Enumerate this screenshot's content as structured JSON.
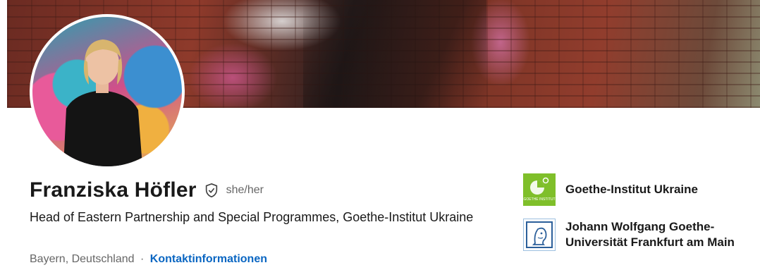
{
  "profile": {
    "name": "Franziska Höfler",
    "pronouns": "she/her",
    "headline": "Head of Eastern Partnership and Special Programmes, Goethe-Institut Ukraine",
    "location": "Bayern, Deutschland",
    "separator": "·",
    "contact_link": "Kontaktinformationen",
    "verified_icon": "shield-check-icon"
  },
  "organizations": [
    {
      "name": "Goethe-Institut Ukraine",
      "logo": "goethe-institut-logo",
      "logo_text": "GOETHE INSTITUT"
    },
    {
      "name": "Johann Wolfgang Goethe-Universität Frankfurt am Main",
      "logo": "goethe-university-logo"
    }
  ],
  "colors": {
    "link": "#0a66c2",
    "goethe_green": "#7fbf2a",
    "text_primary": "#191919",
    "text_secondary": "#666666"
  }
}
